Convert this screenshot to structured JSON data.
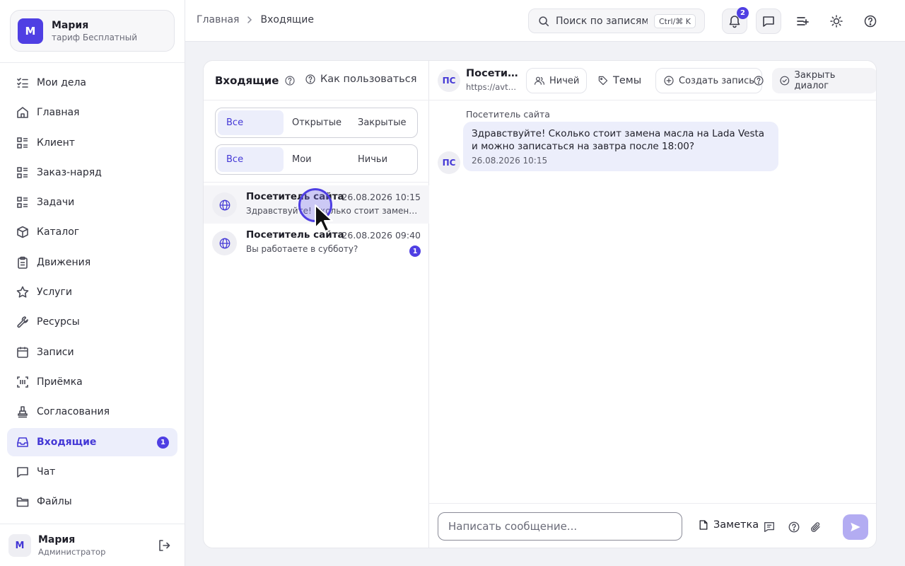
{
  "account": {
    "initial": "М",
    "name": "Мария",
    "plan": "тариф Бесплатный"
  },
  "nav": [
    {
      "label": "Мои дела",
      "icon": "checklist-icon"
    },
    {
      "label": "Главная",
      "icon": "home-icon"
    },
    {
      "label": "Клиент",
      "icon": "list-icon"
    },
    {
      "label": "Заказ-наряд",
      "icon": "list-icon"
    },
    {
      "label": "Задачи",
      "icon": "list-icon"
    },
    {
      "label": "Каталог",
      "icon": "box-icon"
    },
    {
      "label": "Движения",
      "icon": "clipboard-icon"
    },
    {
      "label": "Услуги",
      "icon": "star-icon"
    },
    {
      "label": "Ресурсы",
      "icon": "wrench-icon"
    },
    {
      "label": "Записи",
      "icon": "calendar-icon"
    },
    {
      "label": "Приёмка",
      "icon": "scan-icon"
    },
    {
      "label": "Согласования",
      "icon": "stamp-icon"
    },
    {
      "label": "Входящие",
      "icon": "inbox-icon",
      "active": true,
      "badge": "1"
    },
    {
      "label": "Чат",
      "icon": "chat-icon"
    },
    {
      "label": "Файлы",
      "icon": "folder-icon"
    }
  ],
  "user": {
    "initial": "М",
    "name": "Мария",
    "role": "Администратор"
  },
  "header": {
    "breadcrumb": [
      "Главная",
      "Входящие"
    ],
    "search_placeholder": "Поиск по записям",
    "search_shortcut": "Ctrl/⌘ K",
    "notifications_count": "2"
  },
  "inbox": {
    "title": "Входящие",
    "howto": "Как пользоваться",
    "filter_status": [
      "Все",
      "Открытые",
      "Закрытые"
    ],
    "filter_owner": [
      "Все",
      "Мои",
      "Ничьи"
    ],
    "conversations": [
      {
        "name": "Посетитель сайта",
        "time": "26.08.2026 10:15",
        "preview": "Здравствуйте! Сколько стоит замена масла на Lada Vesta и можно записаться на завтра после 18:00?"
      },
      {
        "name": "Посетитель сайта",
        "time": "26.08.2026 09:40",
        "preview": "Вы работаете в субботу?",
        "unread": "1"
      }
    ]
  },
  "chat": {
    "avatar": "ПС",
    "name": "Посетитель сайта",
    "url": "https://avtoservis.ru",
    "owner_btn": "Ничей",
    "topics_btn": "Темы",
    "create_btn": "Создать запись",
    "close_btn": "Закрыть диалог",
    "message": {
      "sender": "Посетитель сайта",
      "text": "Здравствуйте! Сколько стоит замена масла на Lada Vesta и можно записаться на завтра после 18:00?",
      "time": "26.08.2026 10:15"
    },
    "composer_placeholder": "Написать сообщение...",
    "note_btn": "Заметка"
  },
  "colors": {
    "accent": "#4f3fe3",
    "active_bg": "#eceefb",
    "page_bg": "#f1f2f6"
  }
}
